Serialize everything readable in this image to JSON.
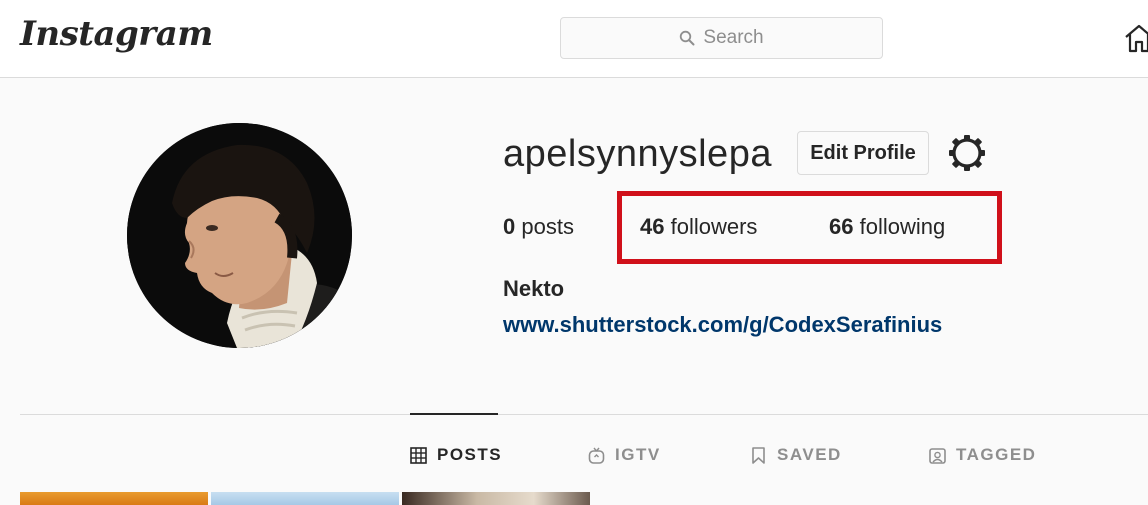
{
  "header": {
    "logo_text": "Instagram",
    "search_placeholder": "Search",
    "home_icon": "home-icon"
  },
  "profile": {
    "username": "apelsynnyslepa",
    "edit_button_label": "Edit Profile",
    "settings_icon": "gear-icon",
    "stats": {
      "posts_count": "0",
      "posts_label": "posts",
      "followers_count": "46",
      "followers_label": "followers",
      "following_count": "66",
      "following_label": "following"
    },
    "full_name": "Nekto",
    "website": "www.shutterstock.com/g/CodexSerafinius"
  },
  "annotation": {
    "highlight_color": "#d0101a"
  },
  "tabs": [
    {
      "label": "POSTS",
      "icon": "grid-icon",
      "active": true
    },
    {
      "label": "IGTV",
      "icon": "tv-icon",
      "active": false
    },
    {
      "label": "SAVED",
      "icon": "bookmark-icon",
      "active": false
    },
    {
      "label": "TAGGED",
      "icon": "tag-portrait-icon",
      "active": false
    }
  ],
  "colors": {
    "link": "#00376b",
    "text": "#262626",
    "muted": "#8e8e8e",
    "border": "#dbdbdb"
  }
}
